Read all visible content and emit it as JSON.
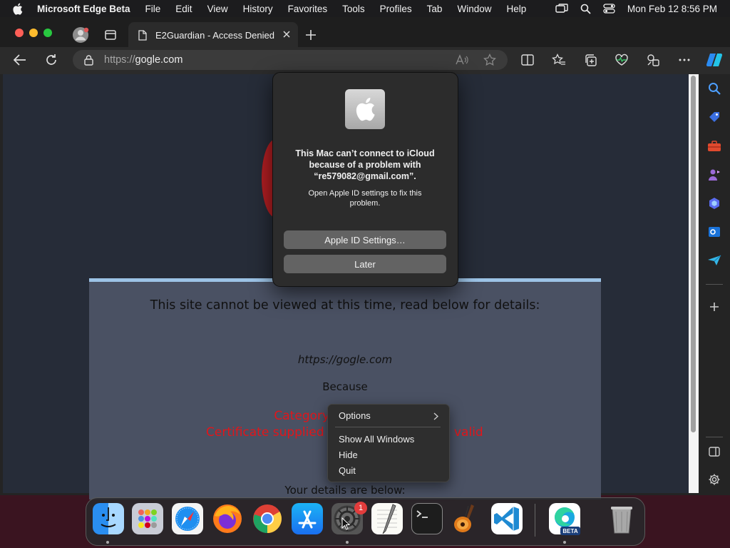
{
  "menubar": {
    "app_name": "Microsoft Edge Beta",
    "items": [
      "File",
      "Edit",
      "View",
      "History",
      "Favorites",
      "Tools",
      "Profiles",
      "Tab",
      "Window",
      "Help"
    ],
    "clock": "Mon Feb 12  8:56 PM"
  },
  "tab": {
    "title": "E2Guardian - Access Denied"
  },
  "address": {
    "protocol": "https://",
    "host": "gogle.com"
  },
  "page": {
    "title": "This site cannot be viewed at this time, read below for details:",
    "url": "https://gogle.com",
    "because": "Because",
    "category_visible": "Category: SS",
    "certificate_visible_left": "Certificate supplied",
    "certificate_visible_right": "valid",
    "details_heading": "Your details are below:"
  },
  "alert": {
    "title": "This Mac can’t connect to iCloud because of a problem with “re579082@gmail.com”.",
    "body": "Open Apple ID settings to fix this problem.",
    "primary_button": "Apple ID Settings…",
    "secondary_button": "Later"
  },
  "context_menu": {
    "items": [
      "Options",
      "Show All Windows",
      "Hide",
      "Quit"
    ]
  },
  "dock": {
    "apps": [
      "Finder",
      "Launchpad",
      "Safari",
      "Firefox",
      "Google Chrome",
      "App Store",
      "System Settings",
      "TextEdit",
      "Terminal",
      "GarageBand",
      "Visual Studio Code",
      "Microsoft Edge Beta",
      "Trash"
    ],
    "badge": "1",
    "edge_label": "BETA"
  },
  "colors": {
    "content_bg": "#262c38",
    "panel_bg": "#4a5163",
    "panel_border": "#9cc3e6",
    "alert_red": "#e2151a"
  }
}
